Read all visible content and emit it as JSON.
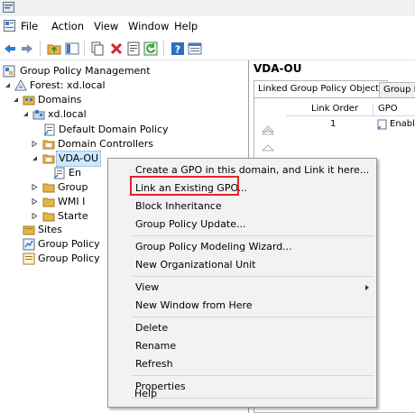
{
  "menubar": {
    "items": [
      "File",
      "Action",
      "View",
      "Window",
      "Help"
    ]
  },
  "tree": {
    "root": "Group Policy Management",
    "forest": "Forest: xd.local",
    "domains": "Domains",
    "domain": "xd.local",
    "default_policy": "Default Domain Policy",
    "domain_controllers": "Domain Controllers",
    "vda_ou": "VDA-OU",
    "child_en": "En",
    "group": "Group",
    "wmi": "WMI I",
    "starter": "Starte",
    "sites": "Sites",
    "gp_modeling": "Group Policy",
    "gp_results": "Group Policy"
  },
  "right_pane": {
    "title": "VDA-OU",
    "tabs": [
      "Linked Group Policy Objects",
      "Group Poli"
    ],
    "columns": [
      "Link Order",
      "GPO"
    ],
    "row": {
      "link_order": "1",
      "gpo": "Enabl"
    }
  },
  "context_menu": {
    "items": [
      "Create a GPO in this domain, and Link it here...",
      "Link an Existing GPO...",
      "Block Inheritance",
      "Group Policy Update...",
      "Group Policy Modeling Wizard...",
      "New Organizational Unit",
      "View",
      "New Window from Here",
      "Delete",
      "Rename",
      "Refresh",
      "Properties",
      "Help"
    ]
  },
  "colors": {
    "highlight_box": "#e8202a",
    "selection": "#cce8ff"
  }
}
